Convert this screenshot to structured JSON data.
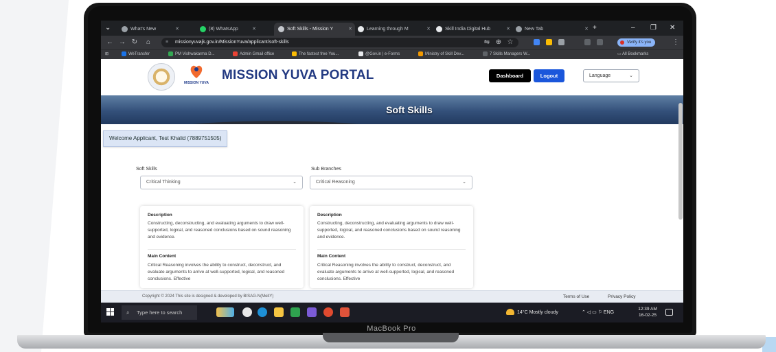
{
  "browser": {
    "tabs": [
      {
        "label": "What's New",
        "icon": "chrome-icon",
        "active": false
      },
      {
        "label": "(8) WhatsApp",
        "icon": "whatsapp-icon",
        "active": false
      },
      {
        "label": "Soft Skills - Mission Y",
        "icon": "site-icon",
        "active": true
      },
      {
        "label": "Learning through M",
        "icon": "globe-icon",
        "active": false
      },
      {
        "label": "Skill India Digital Hub",
        "icon": "skill-icon",
        "active": false
      },
      {
        "label": "New Tab",
        "icon": "chrome-icon",
        "active": false
      }
    ],
    "url": "missionyuvajk.gov.in/MissionYuva/applicant/soft-skills",
    "verify_label": "Verify it's you",
    "bookmarks": [
      "WeTransfer",
      "PM Vishwakarma D...",
      "Admin Gmail office",
      "The fastest free You...",
      "@Gov.in | e-Forms",
      "Ministry of Skill Dev...",
      "7 Skills Managers W..."
    ],
    "all_bookmarks": "All Bookmarks",
    "colors": {
      "tabbar": "#1f2124",
      "toolbar": "#35363a",
      "accent": "#8ab4f8"
    }
  },
  "site": {
    "logo_text": "MISSION YUVA",
    "title": "MISSION YUVA PORTAL",
    "dashboard_label": "Dashboard",
    "logout_label": "Logout",
    "language_label": "Language",
    "banner_title": "Soft Skills",
    "welcome": "Welcome Applicant, Test Khalid (7889751505)",
    "colors": {
      "title": "#233a82",
      "logout": "#1a56db",
      "dashboard": "#000000"
    }
  },
  "form": {
    "soft_skills": {
      "label": "Soft Skills",
      "value": "Critical Thinking"
    },
    "sub_branches": {
      "label": "Sub Branches",
      "value": "Critical Reasoning"
    }
  },
  "cards": [
    {
      "description_heading": "Description",
      "description": "Constructing, deconstructing, and evaluating arguments to draw well-supported, logical, and reasoned conclusions based on sound reasoning and evidence.",
      "main_heading": "Main Content",
      "main_content": "Critical Reasoning involves the ability to construct, deconstruct, and evaluate arguments to arrive at well-supported, logical, and reasoned conclusions. Effective"
    },
    {
      "description_heading": "Description",
      "description": "Constructing, deconstructing, and evaluating arguments to draw well-supported, logical, and reasoned conclusions based on sound reasoning and evidence.",
      "main_heading": "Main Content",
      "main_content": "Critical Reasoning involves the ability to construct, deconstruct, and evaluate arguments to arrive at well-supported, logical, and reasoned conclusions. Effective"
    }
  ],
  "footer": {
    "copyright": "Copyright © 2024 This site is designed & developed by BISAG-N(MeitY)",
    "terms": "Terms of Use",
    "privacy": "Privacy Policy"
  },
  "taskbar": {
    "search_placeholder": "Type here to search",
    "weather": "14°C  Mostly cloudy",
    "lang": "ENG",
    "time": "12:39 AM",
    "date": "16-02-25"
  },
  "device_label": "MacBook Pro"
}
